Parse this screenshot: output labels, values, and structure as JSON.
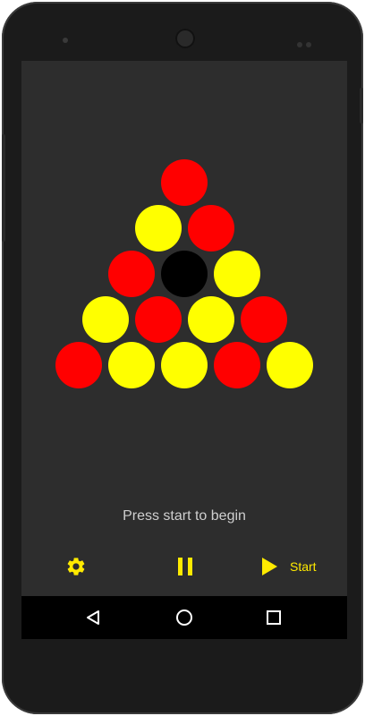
{
  "app": {
    "status_text": "Press start to begin",
    "start_label": "Start"
  },
  "colors": {
    "accent": "#ffea00",
    "red": "#ff0000",
    "yellow": "#ffff00",
    "empty": "#000000",
    "background": "#2d2d2d"
  },
  "board": {
    "rows": [
      [
        "red"
      ],
      [
        "yellow",
        "red"
      ],
      [
        "red",
        "empty",
        "yellow"
      ],
      [
        "yellow",
        "red",
        "yellow",
        "red"
      ],
      [
        "red",
        "yellow",
        "yellow",
        "red",
        "yellow"
      ]
    ]
  },
  "icons": {
    "settings": "gear-icon",
    "pause": "pause-icon",
    "start": "play-icon",
    "back": "back-icon",
    "home": "home-icon",
    "recent": "recent-apps-icon"
  }
}
